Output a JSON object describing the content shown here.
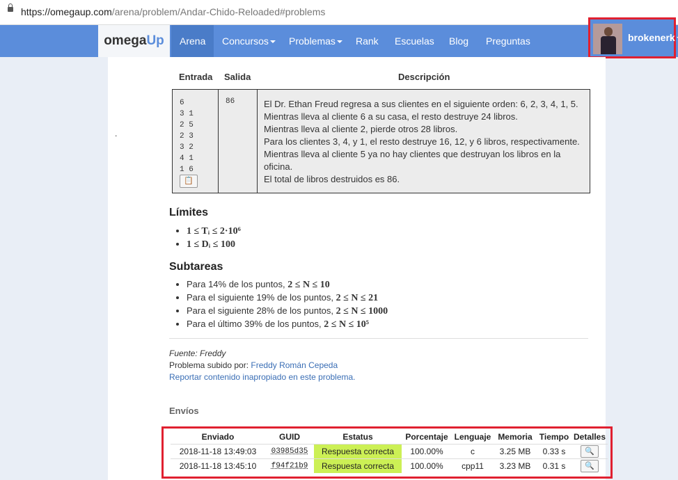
{
  "browser": {
    "url_host": "https://omegaup.com",
    "url_path": "/arena/problem/Andar-Chido-Reloaded#problems"
  },
  "nav": {
    "logo_a": "omega",
    "logo_b": "Up",
    "items": [
      "Arena",
      "Concursos",
      "Problemas",
      "Rank",
      "Escuelas",
      "Blog",
      "Preguntas"
    ],
    "username": "brokenerk"
  },
  "example": {
    "headers": [
      "Entrada",
      "Salida",
      "Descripción"
    ],
    "input": "6\n3 1\n2 5\n2 3\n3 2\n4 1\n1 6",
    "output": "86",
    "description": [
      "El Dr. Ethan Freud regresa a sus clientes en el siguiente orden: 6, 2, 3, 4, 1, 5.",
      "Mientras lleva al cliente 6 a su casa, el resto destruye 24 libros.",
      "Mientras lleva al cliente 2, pierde otros 28 libros.",
      "Para los clientes 3, 4, y 1, el resto destruye 16, 12, y 6 libros, respectivamente.",
      "Mientras lleva al cliente 5 ya no hay clientes que destruyan los libros en la oficina.",
      "El total de libros destruidos es 86."
    ]
  },
  "limites": {
    "title": "Límites",
    "items": [
      "1 ≤ Tᵢ ≤ 2·10⁶",
      "1 ≤ Dᵢ ≤ 100"
    ]
  },
  "subtareas": {
    "title": "Subtareas",
    "items": [
      {
        "text": "Para 14% de los puntos, ",
        "math": "2 ≤ N ≤ 10"
      },
      {
        "text": "Para el siguiente 19% de los puntos, ",
        "math": "2 ≤ N ≤ 21"
      },
      {
        "text": "Para el siguiente 28% de los puntos, ",
        "math": "2 ≤ N ≤ 1000"
      },
      {
        "text": "Para el último 39% de los puntos, ",
        "math": "2 ≤ N ≤ 10⁵"
      }
    ]
  },
  "source": {
    "fuente": "Fuente: Freddy",
    "subido_label": "Problema subido por: ",
    "author": "Freddy Román Cepeda",
    "report": "Reportar contenido inapropiado en este problema."
  },
  "submissions": {
    "title": "Envíos",
    "headers": [
      "Enviado",
      "GUID",
      "Estatus",
      "Porcentaje",
      "Lenguaje",
      "Memoria",
      "Tiempo",
      "Detalles"
    ],
    "rows": [
      [
        "2018-11-18 13:49:03",
        "03985d35",
        "Respuesta correcta",
        "100.00%",
        "c",
        "3.25 MB",
        "0.33 s"
      ],
      [
        "2018-11-18 13:45:10",
        "f94f21b9",
        "Respuesta correcta",
        "100.00%",
        "cpp11",
        "3.23 MB",
        "0.31 s"
      ]
    ]
  }
}
